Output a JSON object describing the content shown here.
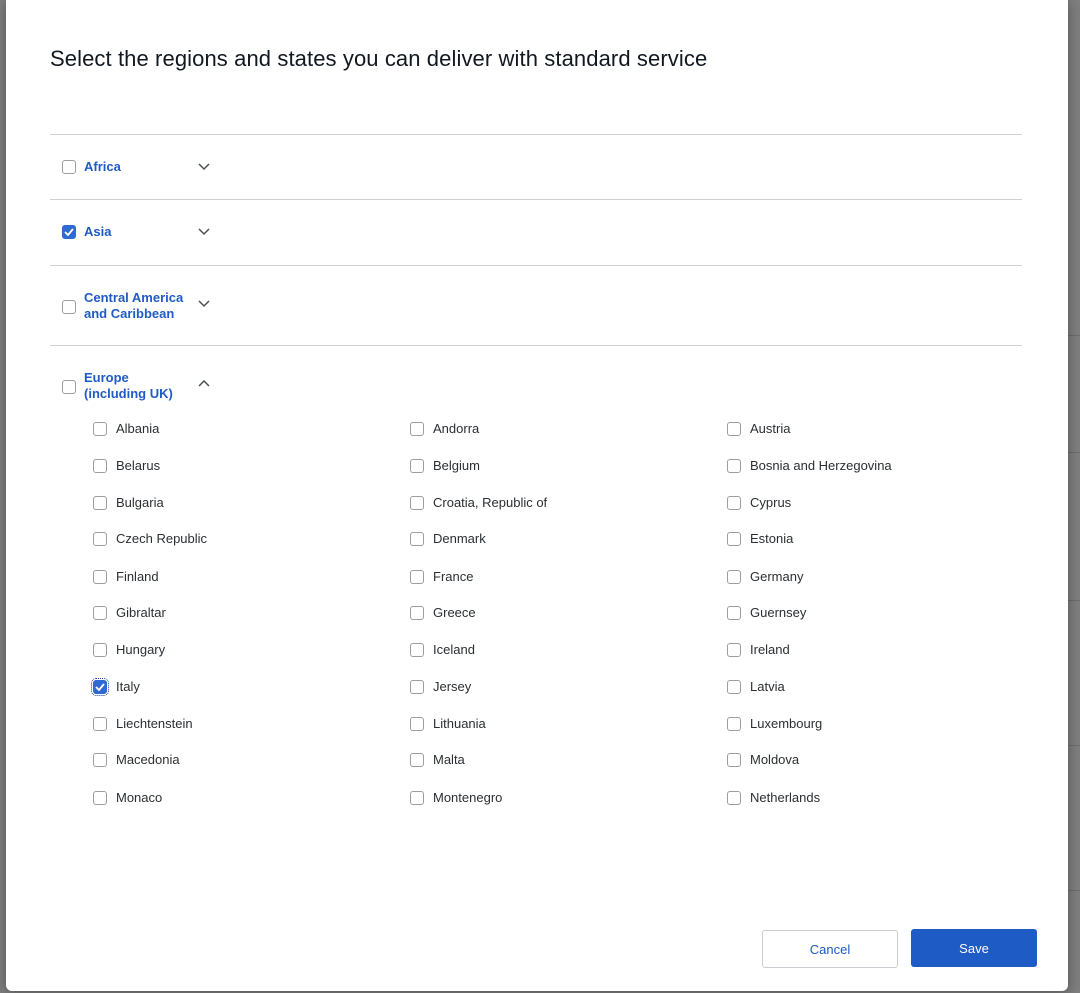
{
  "dialog": {
    "title": "Select the regions and states you can deliver with standard service"
  },
  "regions": [
    {
      "line1": "Africa",
      "line2": "",
      "checked": false,
      "expanded": false
    },
    {
      "line1": "Asia",
      "line2": "",
      "checked": true,
      "expanded": false
    },
    {
      "line1": "Central America",
      "line2": "and Caribbean",
      "checked": false,
      "expanded": false
    },
    {
      "line1": "Europe",
      "line2": "(including UK)",
      "checked": false,
      "expanded": true
    }
  ],
  "countries": [
    {
      "label": "Albania",
      "checked": false
    },
    {
      "label": "Andorra",
      "checked": false
    },
    {
      "label": "Austria",
      "checked": false
    },
    {
      "label": "Belarus",
      "checked": false
    },
    {
      "label": "Belgium",
      "checked": false
    },
    {
      "label": "Bosnia and Herzegovina",
      "checked": false
    },
    {
      "label": "Bulgaria",
      "checked": false
    },
    {
      "label": "Croatia, Republic of",
      "checked": false
    },
    {
      "label": "Cyprus",
      "checked": false
    },
    {
      "label": "Czech Republic",
      "checked": false
    },
    {
      "label": "Denmark",
      "checked": false
    },
    {
      "label": "Estonia",
      "checked": false
    },
    {
      "label": "Finland",
      "checked": false
    },
    {
      "label": "France",
      "checked": false
    },
    {
      "label": "Germany",
      "checked": false
    },
    {
      "label": "Gibraltar",
      "checked": false
    },
    {
      "label": "Greece",
      "checked": false
    },
    {
      "label": "Guernsey",
      "checked": false
    },
    {
      "label": "Hungary",
      "checked": false
    },
    {
      "label": "Iceland",
      "checked": false
    },
    {
      "label": "Ireland",
      "checked": false
    },
    {
      "label": "Italy",
      "checked": true
    },
    {
      "label": "Jersey",
      "checked": false
    },
    {
      "label": "Latvia",
      "checked": false
    },
    {
      "label": "Liechtenstein",
      "checked": false
    },
    {
      "label": "Lithuania",
      "checked": false
    },
    {
      "label": "Luxembourg",
      "checked": false
    },
    {
      "label": "Macedonia",
      "checked": false
    },
    {
      "label": "Malta",
      "checked": false
    },
    {
      "label": "Moldova",
      "checked": false
    },
    {
      "label": "Monaco",
      "checked": false
    },
    {
      "label": "Montenegro",
      "checked": false
    },
    {
      "label": "Netherlands",
      "checked": false
    }
  ],
  "buttons": {
    "cancel": "Cancel",
    "save": "Save"
  },
  "colors": {
    "accent": "#1f5bc4",
    "checkbox_checked": "#2e6ad1"
  }
}
